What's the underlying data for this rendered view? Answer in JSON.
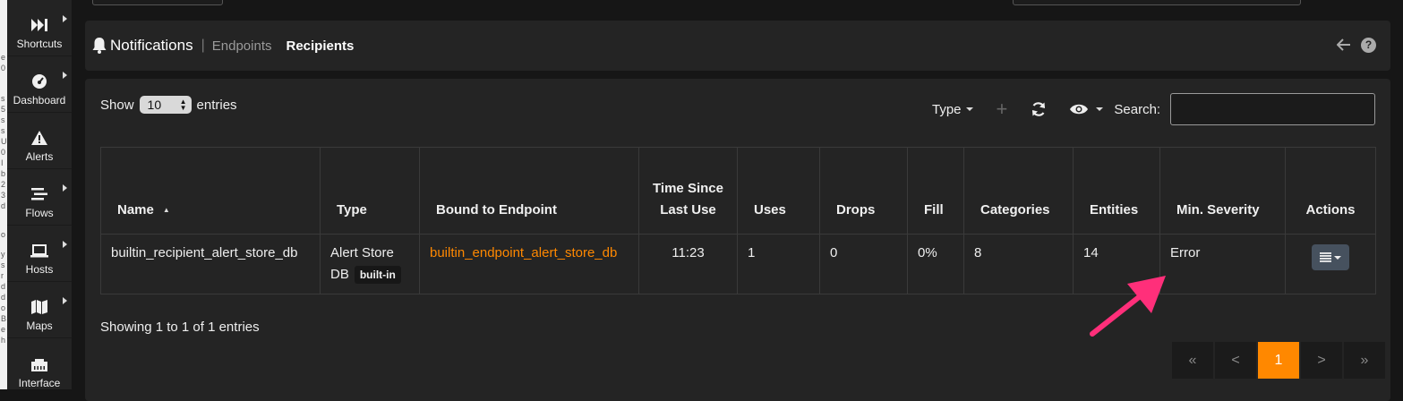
{
  "edge_fragments": [
    "e",
    "0",
    "s",
    "5",
    "s",
    "s",
    "U",
    "0",
    "I",
    "b",
    "2",
    "3",
    "d",
    "o",
    "y",
    "s",
    "r",
    "d",
    "d",
    "o",
    "B",
    "e",
    "h"
  ],
  "sidebar": {
    "items": [
      {
        "label": "Shortcuts",
        "icon": "fast-forward-icon",
        "has_caret": true
      },
      {
        "label": "Dashboard",
        "icon": "gauge-icon",
        "has_caret": true
      },
      {
        "label": "Alerts",
        "icon": "warning-icon",
        "has_caret": false
      },
      {
        "label": "Flows",
        "icon": "stream-icon",
        "has_caret": true
      },
      {
        "label": "Hosts",
        "icon": "laptop-icon",
        "has_caret": true
      },
      {
        "label": "Maps",
        "icon": "map-icon",
        "has_caret": true
      },
      {
        "label": "Interface",
        "icon": "ethernet-icon",
        "has_caret": false
      }
    ]
  },
  "header": {
    "title": "Notifications",
    "separator": "|",
    "crumb_endpoints": "Endpoints",
    "crumb_recipients": "Recipients",
    "help": "?"
  },
  "controls": {
    "show_label": "Show",
    "entries_label": "entries",
    "page_size": "10",
    "type_label": "Type",
    "plus": "+",
    "search_label": "Search:",
    "search_value": ""
  },
  "table": {
    "headers": {
      "name": "Name",
      "type": "Type",
      "bound": "Bound to Endpoint",
      "time": "Time Since Last Use",
      "uses": "Uses",
      "drops": "Drops",
      "fill": "Fill",
      "categories": "Categories",
      "entities": "Entities",
      "severity": "Min. Severity",
      "actions": "Actions"
    },
    "sort_arrow": "▲",
    "rows": [
      {
        "name": "builtin_recipient_alert_store_db",
        "type": "Alert Store DB",
        "badge": "built-in",
        "bound": "builtin_endpoint_alert_store_db",
        "time": "11:23",
        "uses": "1",
        "drops": "0",
        "fill": "0%",
        "categories": "8",
        "entities": "14",
        "severity": "Error"
      }
    ]
  },
  "info": "Showing 1 to 1 of 1 entries",
  "pagination": {
    "first": "«",
    "prev": "<",
    "current": "1",
    "next": ">",
    "last": "»"
  },
  "colors": {
    "accent": "#ff8800",
    "annotation": "#ff2f7a",
    "card": "#242424",
    "background": "#161616"
  }
}
